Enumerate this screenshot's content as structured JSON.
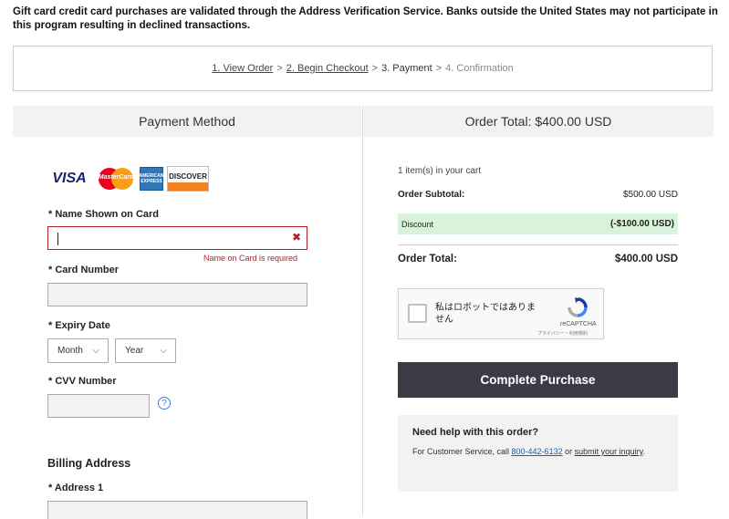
{
  "notice": "Gift card credit card purchases are validated through the Address Verification Service.  Banks outside the United States may not participate in this program resulting in declined transactions.",
  "steps": {
    "step1": "1. View Order",
    "step2": "2. Begin Checkout",
    "step3": "3. Payment",
    "step4": "4. Confirmation",
    "separator": ">"
  },
  "payment": {
    "heading": "Payment Method",
    "cards": {
      "visa": "VISA",
      "mastercard": "MasterCard",
      "amex": "AMERICAN EXPRESS",
      "discover": "DISCOVER"
    },
    "name_label": "* Name Shown on Card",
    "name_value": "",
    "name_error": "Name on Card is required",
    "card_label": "* Card Number",
    "expiry_label": "* Expiry Date",
    "month": "Month",
    "year": "Year",
    "cvv_label": "* CVV Number",
    "cvv_help": "?",
    "billing_heading": "Billing Address",
    "address1_label": "* Address 1"
  },
  "summary": {
    "heading": "Order Total: $400.00 USD",
    "items": "1 item(s) in your cart",
    "subtotal_label": "Order Subtotal:",
    "subtotal_value": "$500.00 USD",
    "discount_label": "Discount",
    "discount_value": "(-$100.00 USD)",
    "total_label": "Order Total:",
    "total_value": "$400.00 USD",
    "discount_color": "#d9f3da"
  },
  "captcha": {
    "text": "私はロボットではありません",
    "brand": "reCAPTCHA",
    "privacy": "プライバシー・利用規約"
  },
  "button": {
    "label": "Complete Purchase",
    "color": "#3e3a45"
  },
  "help": {
    "title": "Need help with this order?",
    "text_prefix": "For Customer Service, call ",
    "phone": "800-442-6132",
    "or": " or ",
    "link": "submit your inquiry",
    "suffix": "."
  },
  "error_color": "#b32025"
}
